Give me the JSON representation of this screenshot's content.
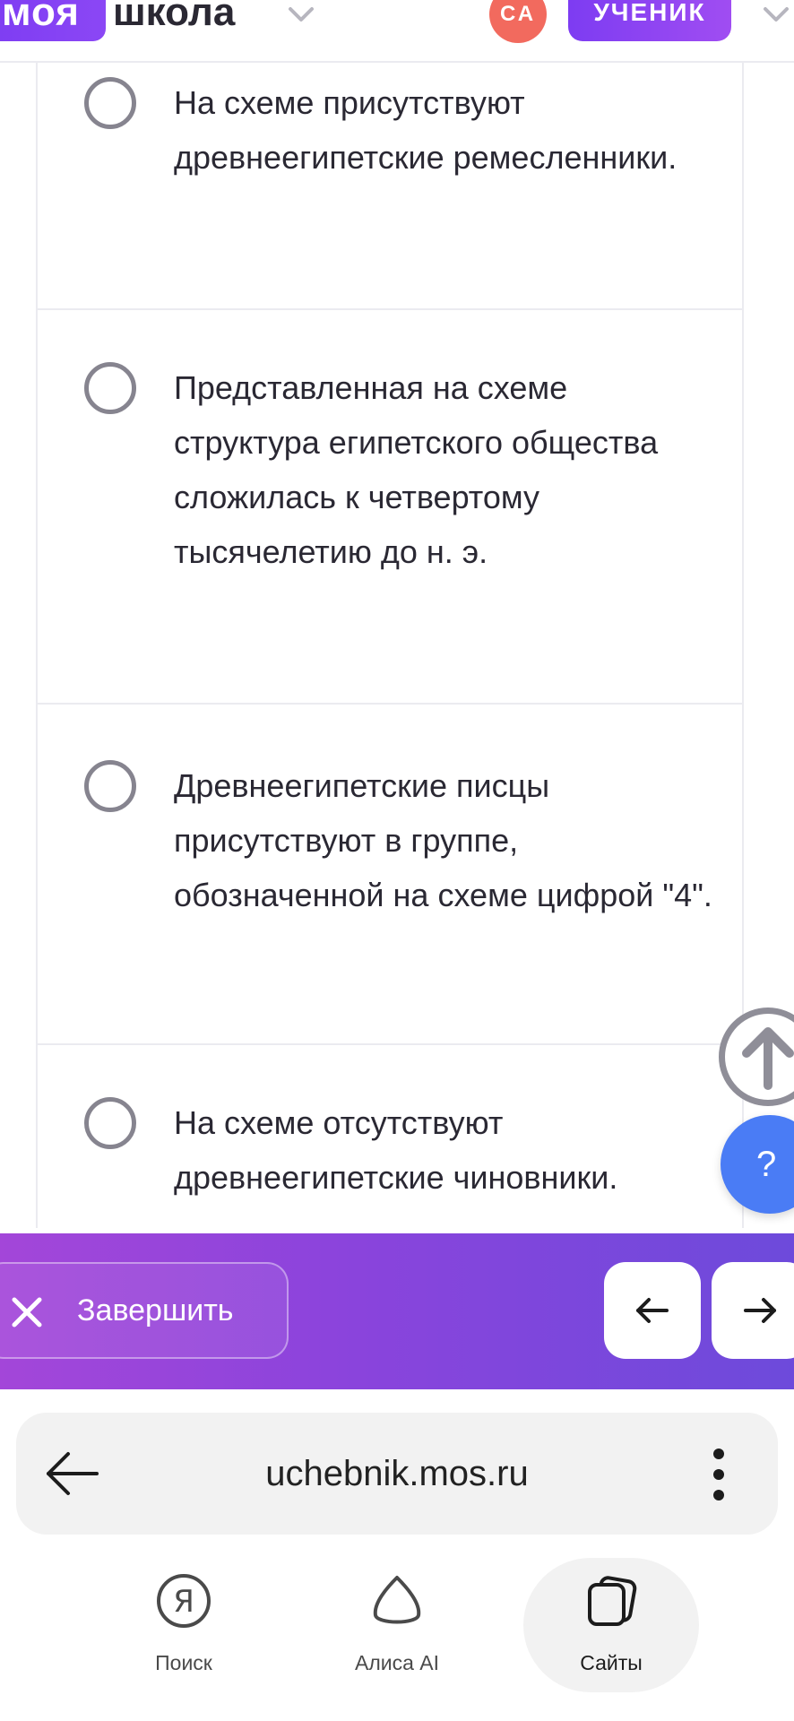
{
  "header": {
    "logo_part1": "моя",
    "logo_part2": "школа",
    "logo_chevron_icon": "chevron-down-icon",
    "avatar_initials": "СА",
    "role_label": "УЧЕНИК",
    "role_chevron_icon": "chevron-down-icon"
  },
  "options": [
    {
      "text": "На схеме присутствуют древнеегипетские ремесленники."
    },
    {
      "text": "Представленная на схеме структура египетского общества сложилась к четвертому тысячелетию до н. э."
    },
    {
      "text": "Древнеегипетские писцы присутствуют в группе, обозначенной на схеме цифрой \"4\"."
    },
    {
      "text": "На схеме отсутствуют древнеегипетские чиновники."
    }
  ],
  "floating": {
    "scroll_top_icon": "arrow-up-icon",
    "help_label": "?"
  },
  "action_bar": {
    "finish_label": "Завершить",
    "finish_icon": "close-icon",
    "prev_icon": "arrow-left-icon",
    "next_icon": "arrow-right-icon"
  },
  "browser": {
    "url": "uchebnik.mos.ru",
    "back_icon": "arrow-left-icon",
    "menu_icon": "more-vertical-icon",
    "tabs": [
      {
        "label": "Поиск",
        "icon": "yandex-icon"
      },
      {
        "label": "Алиса AI",
        "icon": "alice-icon"
      },
      {
        "label": "Сайты",
        "icon": "tabs-icon"
      }
    ],
    "active_tab": "Сайты"
  },
  "colors": {
    "brand_purple": "#7d3cf2",
    "avatar_red": "#f26a5e",
    "help_blue": "#4a7cf5",
    "radio_gray": "#86848f",
    "text_dark": "#2a2833"
  }
}
